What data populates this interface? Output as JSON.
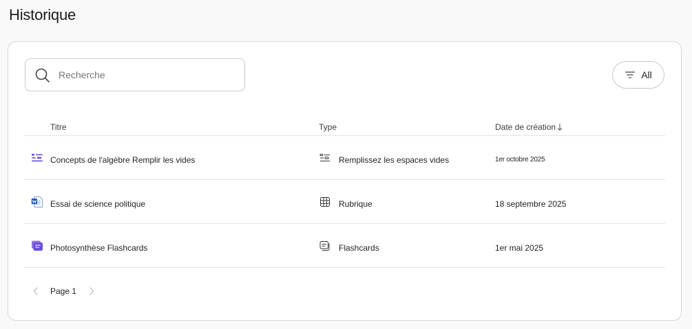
{
  "page": {
    "title": "Historique"
  },
  "search": {
    "placeholder": "Recherche",
    "value": ""
  },
  "filter": {
    "label": "All"
  },
  "table": {
    "columns": {
      "title": "Titre",
      "type": "Type",
      "date": "Date de création"
    },
    "rows": [
      {
        "title": "Concepts de l'algèbre Remplir les vides",
        "type": "Remplissez les espaces vides",
        "date": "1er octobre 2025",
        "icon": "fill-blanks-icon",
        "type_icon": "fill-blanks-icon"
      },
      {
        "title": "Essai de science politique",
        "type": "Rubrique",
        "date": "18 septembre 2025",
        "icon": "word-document-icon",
        "type_icon": "rubric-grid-icon"
      },
      {
        "title": "Photosynthèse Flashcards",
        "type": "Flashcards",
        "date": "1er mai 2025",
        "icon": "flashcards-icon",
        "type_icon": "flashcards-icon"
      }
    ]
  },
  "pagination": {
    "label": "Page 1"
  },
  "colors": {
    "accent": "#6b4fd8",
    "word_blue": "#185abd",
    "border": "#d6d6d6"
  }
}
